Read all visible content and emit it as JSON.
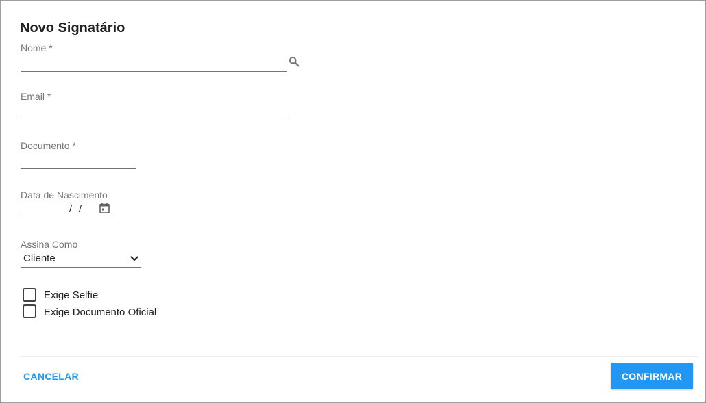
{
  "dialog": {
    "title": "Novo Signatário"
  },
  "form": {
    "nome": {
      "label": "Nome *",
      "value": "",
      "icon": "search-icon"
    },
    "email": {
      "label": "Email *",
      "value": ""
    },
    "documento": {
      "label": "Documento *",
      "value": ""
    },
    "data_nascimento": {
      "label": "Data de Nascimento",
      "separator": "/",
      "icon": "calendar-icon"
    },
    "assina_como": {
      "label": "Assina Como",
      "selected": "Cliente",
      "icon": "chevron-down-icon"
    },
    "checkboxes": [
      {
        "label": "Exige Selfie",
        "checked": false
      },
      {
        "label": "Exige Documento Oficial",
        "checked": false
      }
    ]
  },
  "actions": {
    "cancel_label": "CANCELAR",
    "confirm_label": "CONFIRMAR"
  },
  "colors": {
    "accent": "#2196f3",
    "text": "#212121",
    "muted": "#757575",
    "border": "#9e9e9e"
  }
}
